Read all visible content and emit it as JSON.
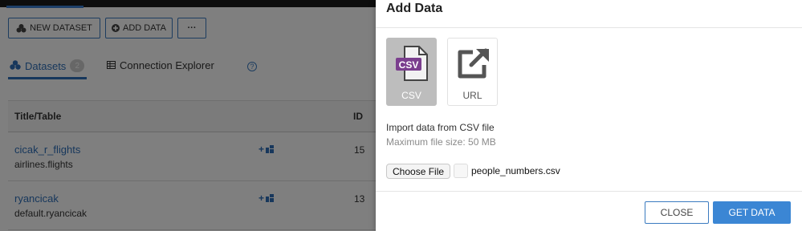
{
  "toolbar": {
    "new_dataset_label": "NEW DATASET",
    "add_data_label": "ADD DATA",
    "more_label": "···"
  },
  "tabs": {
    "datasets_label": "Datasets",
    "datasets_count": "2",
    "connection_explorer_label": "Connection Explorer",
    "help_label": "?"
  },
  "table": {
    "headers": {
      "title": "Title/Table",
      "id": "ID"
    },
    "rows": [
      {
        "name": "cicak_r_flights",
        "table": "airlines.flights",
        "id": "15"
      },
      {
        "name": "ryancicak",
        "table": "default.ryancicak",
        "id": "13"
      }
    ]
  },
  "modal": {
    "title": "Add Data",
    "sources": [
      {
        "label": "CSV",
        "icon": "csv-file-icon",
        "selected": true
      },
      {
        "label": "URL",
        "icon": "external-link-icon",
        "selected": false
      }
    ],
    "description": "Import data from CSV file",
    "max_size": "Maximum file size: 50 MB",
    "choose_file_label": "Choose File",
    "file_name": "people_numbers.csv",
    "close_label": "CLOSE",
    "get_data_label": "GET DATA"
  },
  "colors": {
    "accent": "#3b7bc0",
    "primary_button": "#3b86d4",
    "csv_badge": "#7b3f8e",
    "selected_tile": "#bdbdbd"
  }
}
